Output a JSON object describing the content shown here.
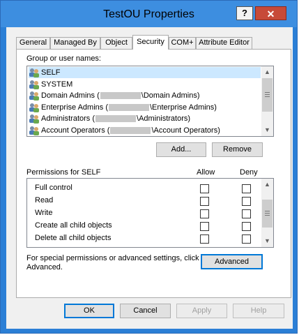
{
  "window": {
    "title": "TestOU Properties",
    "help_label": "?",
    "close_label": "✕"
  },
  "tabs": [
    {
      "label": "General"
    },
    {
      "label": "Managed By"
    },
    {
      "label": "Object"
    },
    {
      "label": "Security",
      "active": true
    },
    {
      "label": "COM+"
    },
    {
      "label": "Attribute Editor"
    }
  ],
  "security": {
    "group_label": "Group or user names:",
    "principals": [
      {
        "pre": "SELF",
        "post": "",
        "redacted": false,
        "icon": "user-group-icon",
        "selected": true
      },
      {
        "pre": "SYSTEM",
        "post": "",
        "redacted": false,
        "icon": "user-group-icon"
      },
      {
        "pre": "Domain Admins (",
        "post": "\\Domain Admins)",
        "redacted": true,
        "icon": "user-group-icon"
      },
      {
        "pre": "Enterprise Admins (",
        "post": "\\Enterprise Admins)",
        "redacted": true,
        "icon": "user-group-icon"
      },
      {
        "pre": "Administrators (",
        "post": "\\Administrators)",
        "redacted": true,
        "icon": "user-group-icon"
      },
      {
        "pre": "Account Operators (",
        "post": "\\Account Operators)",
        "redacted": true,
        "icon": "user-group-icon"
      }
    ],
    "add_label": "Add...",
    "remove_label": "Remove",
    "permissions_label": "Permissions for SELF",
    "allow_label": "Allow",
    "deny_label": "Deny",
    "permissions": [
      {
        "name": "Full control",
        "allow": false,
        "deny": false
      },
      {
        "name": "Read",
        "allow": false,
        "deny": false
      },
      {
        "name": "Write",
        "allow": false,
        "deny": false
      },
      {
        "name": "Create all child objects",
        "allow": false,
        "deny": false
      },
      {
        "name": "Delete all child objects",
        "allow": false,
        "deny": false
      }
    ],
    "special_text_line1": "For special permissions or advanced settings, click",
    "special_text_line2": "Advanced.",
    "advanced_label": "Advanced"
  },
  "footer": {
    "ok_label": "OK",
    "cancel_label": "Cancel",
    "apply_label": "Apply",
    "help_label": "Help"
  },
  "colors": {
    "titlebar": "#3d8ee0",
    "close": "#c74a38",
    "selection": "#cce8ff"
  }
}
